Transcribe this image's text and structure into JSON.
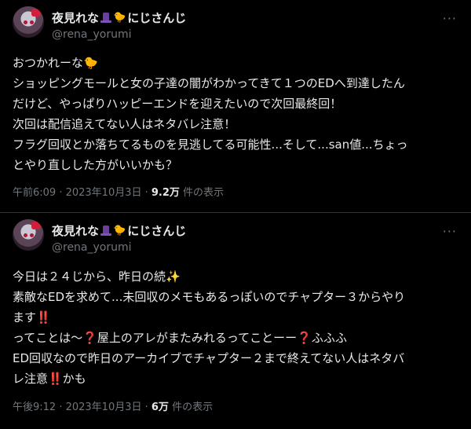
{
  "tweets": [
    {
      "display_name_pre": "夜見れな",
      "display_name_post": "にじさんじ",
      "handle": "@rena_yorumi",
      "more": "···",
      "lines": [
        "おつかれーな🐤",
        "ショッピングモールと女の子達の闇がわかってきて１つのEDへ到達したん",
        "だけど、やっぱりハッピーエンドを迎えたいので次回最終回！",
        "次回は配信追えてない人はネタバレ注意！",
        "フラグ回収とか落ちてるものを見逃してる可能性...そして...san値...ちょっ",
        "とやり直しした方がいいかも？"
      ],
      "time": "午前6:09 · 2023年10月3日 · ",
      "views": "9.2万",
      "views_suffix": " 件の表示"
    },
    {
      "display_name_pre": "夜見れな",
      "display_name_post": "にじさんじ",
      "handle": "@rena_yorumi",
      "more": "···",
      "lines": [
        "今日は２４じから、昨日の続✨",
        "素敵なEDを求めて...未回収のメモもあるっぽいのでチャプター３からやり",
        "ます‼️",
        "ってことは〜❓屋上のアレがまたみれるってことーー❓ふふふ",
        "ED回収なので昨日のアーカイブでチャプター２まで終えてない人はネタバ",
        "レ注意‼️かも"
      ],
      "time": "午後9:12 · 2023年10月3日 · ",
      "views": "6万",
      "views_suffix": " 件の表示"
    }
  ],
  "icons": {
    "display_name_emoji_1": "top-hat-icon",
    "display_name_emoji_2": "chick-icon",
    "more": "more-dots-icon"
  },
  "colors": {
    "background": "#000000",
    "text": "#e7e9ea",
    "secondary": "#71767b",
    "divider": "#2f3336"
  }
}
